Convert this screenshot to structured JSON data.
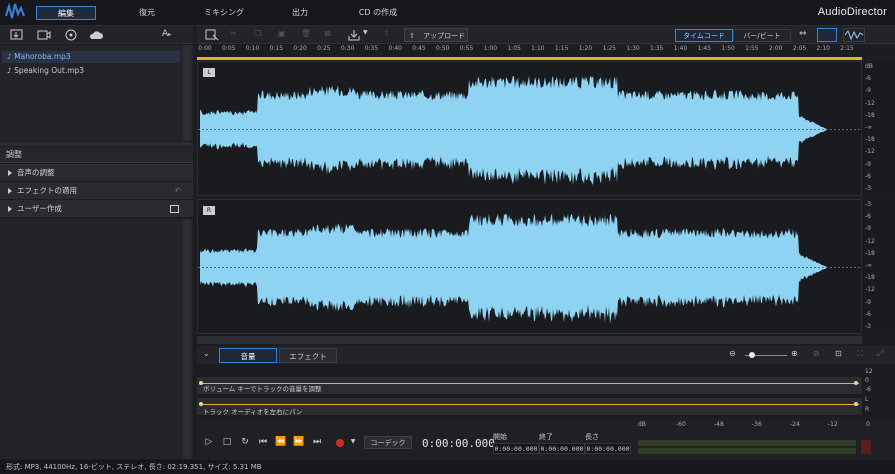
{
  "app": {
    "title": "AudioDirector",
    "tabs": [
      {
        "label": "編集",
        "active": true
      },
      {
        "label": "復元",
        "active": false
      },
      {
        "label": "ミキシング",
        "active": false
      },
      {
        "label": "出力",
        "active": false
      },
      {
        "label": "CD の作成",
        "active": false
      }
    ]
  },
  "media": {
    "items": [
      "Mahoroba.mp3",
      "Speaking Out.mp3"
    ],
    "selected_index": 0,
    "text_size_label": "A"
  },
  "toolbar": {
    "upload_label": "アップロード",
    "timecode_label": "タイムコード",
    "beats_label": "バー/ビート"
  },
  "adjust": {
    "header": "調整",
    "sections": [
      "音声の調整",
      "エフェクトの適用",
      "ユーザー作成"
    ]
  },
  "ruler": {
    "labels": [
      "0:00",
      "0:05",
      "0:10",
      "0:15",
      "0:20",
      "0:25",
      "0:30",
      "0:35",
      "0:40",
      "0:45",
      "0:50",
      "0:55",
      "1:00",
      "1:05",
      "1:10",
      "1:15",
      "1:20",
      "1:25",
      "1:30",
      "1:35",
      "1:40",
      "1:45",
      "1:50",
      "1:55",
      "2:00",
      "2:05",
      "2:10",
      "2:15"
    ]
  },
  "channels": [
    {
      "tag": "L",
      "db_labels": [
        "dB",
        "-6",
        "-9",
        "-12",
        "-18",
        "-∞",
        "-18",
        "-12",
        "-9",
        "-6",
        "-3"
      ]
    },
    {
      "tag": "R",
      "db_labels": [
        "-3",
        "-6",
        "-9",
        "-12",
        "-18",
        "-∞",
        "-18",
        "-12",
        "-9",
        "-6",
        "-3"
      ]
    }
  ],
  "waveform_color": "#8fd3f2",
  "accent_color": "#3a82d6",
  "envelope_color": "#e0b422",
  "bottom_tabs": [
    {
      "label": "音量",
      "active": true
    },
    {
      "label": "エフェクト",
      "active": false
    }
  ],
  "envelopes": [
    {
      "label": "ボリューム キーでトラックの音量を調整",
      "scale": [
        "12",
        "0",
        "-6"
      ]
    },
    {
      "label": "トラック オーディオを左右にパン",
      "scale": [
        "L",
        "R"
      ]
    }
  ],
  "transport": {
    "codec_label": "コーデック",
    "position": "0:00:00.000",
    "start_label": "開始",
    "end_label": "終了",
    "length_label": "長さ",
    "start_value": "0:00:00.000",
    "end_value": "0:00:00.000",
    "length_value": "0:00:00.000",
    "meter_labels": [
      "dB",
      "-60",
      "-48",
      "-36",
      "-24",
      "-12",
      "0"
    ]
  },
  "status": {
    "text": "形式: MP3, 44100Hz, 16-ビット, ステレオ, 長さ: 02:19.351, サイズ: 5.31 MB"
  }
}
